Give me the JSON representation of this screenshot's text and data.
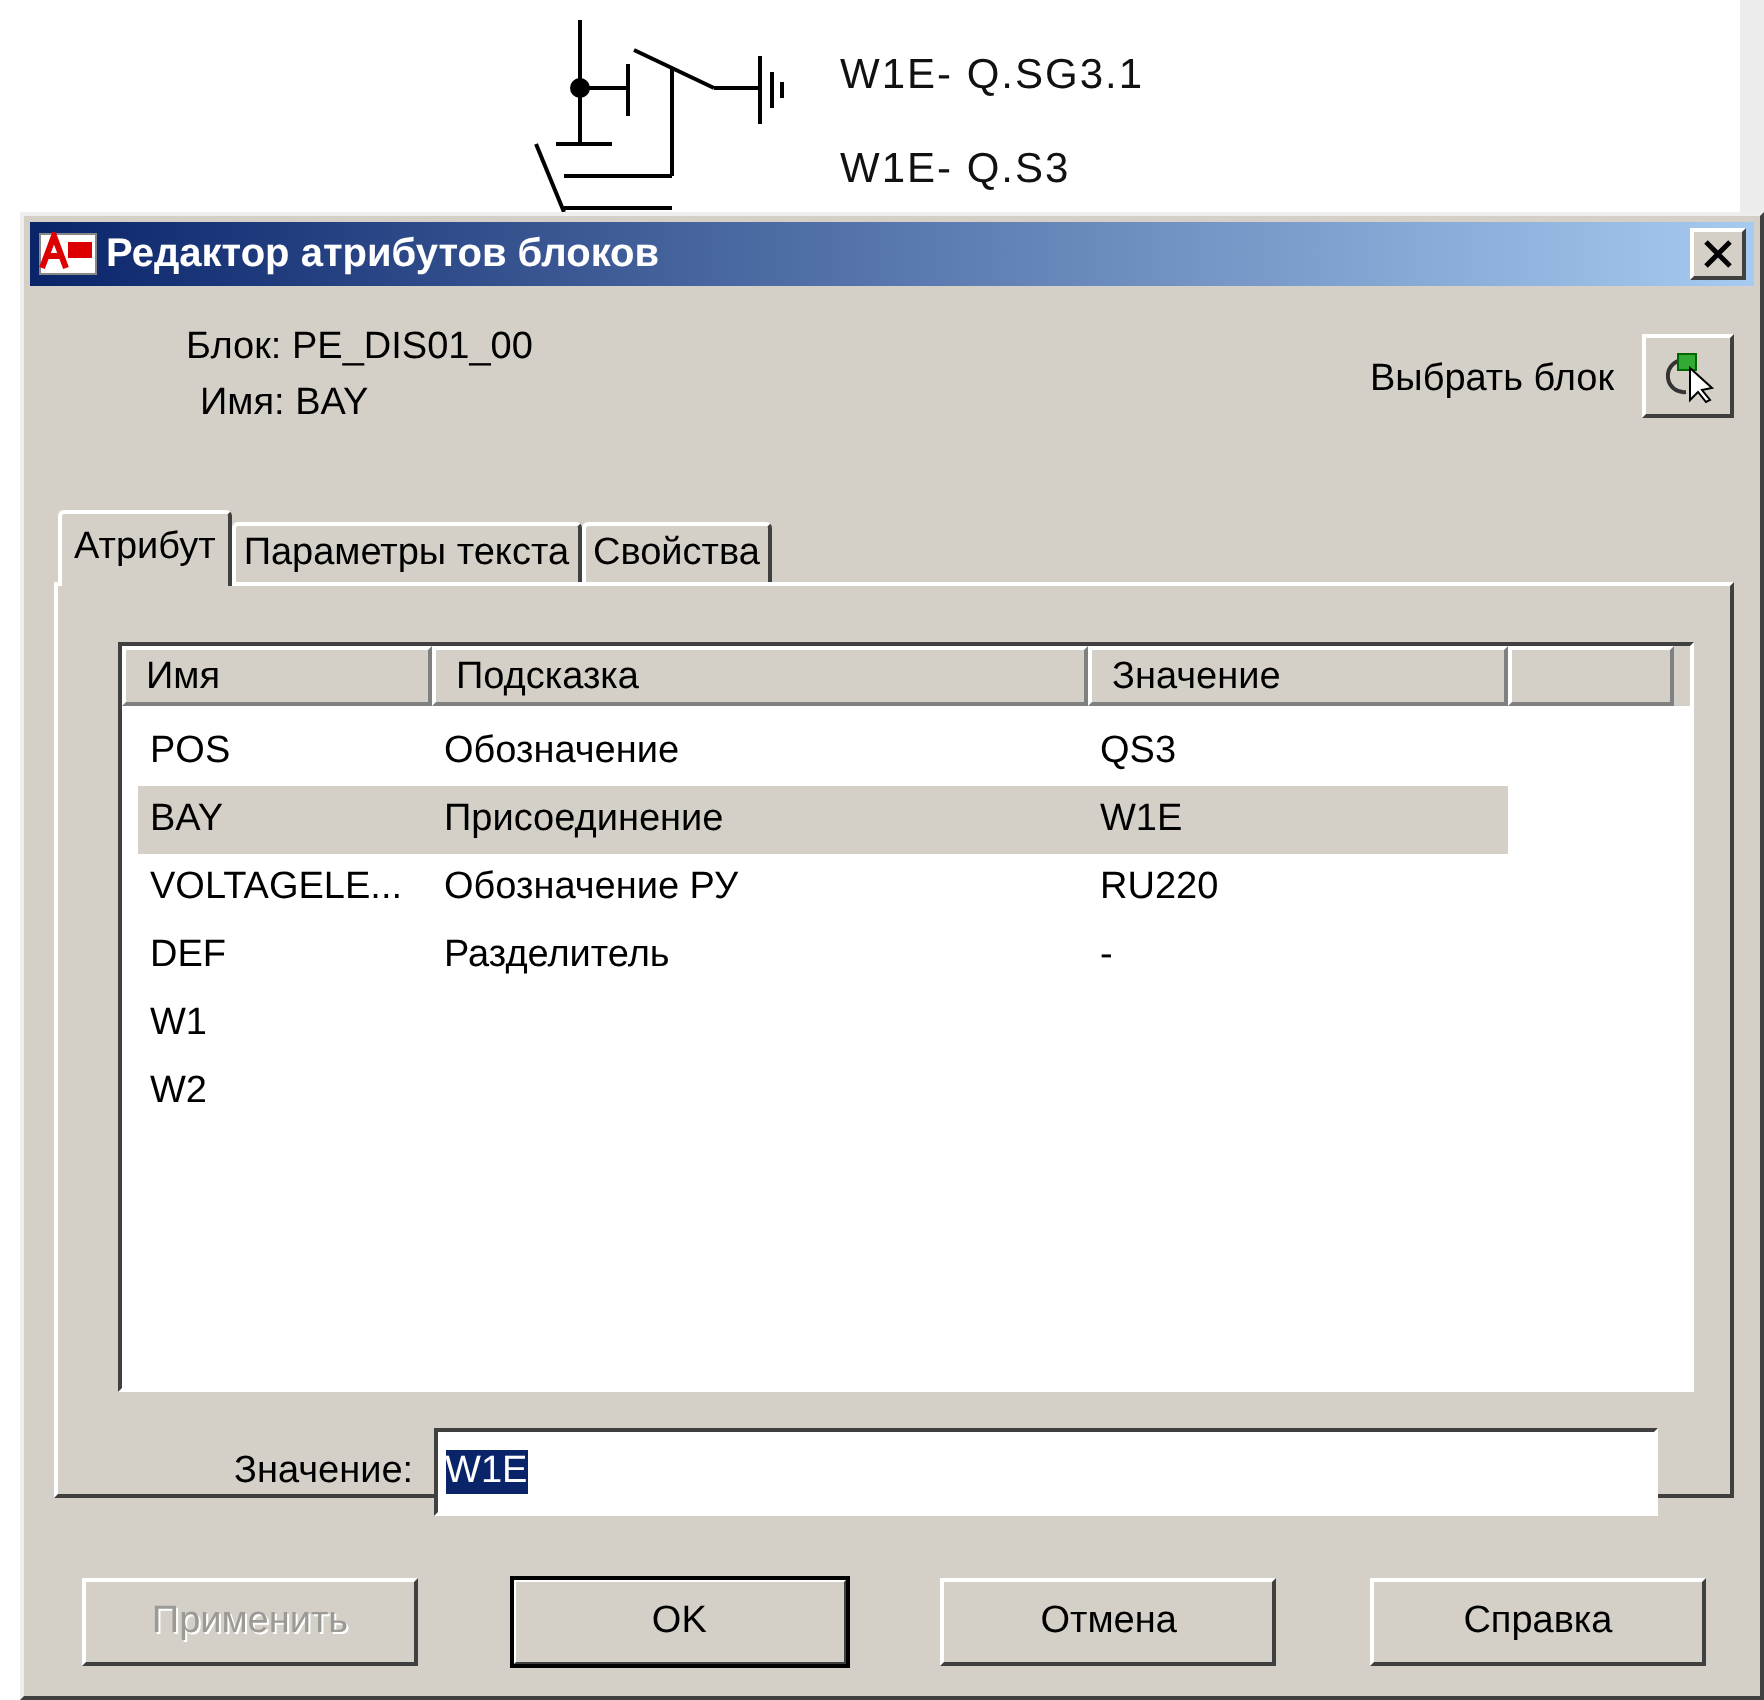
{
  "drawing": {
    "labels": [
      "W1E- Q.SG3.1",
      "W1E- Q.S3"
    ]
  },
  "window": {
    "title": "Редактор атрибутов блоков"
  },
  "block": {
    "block_line": "Блок: PE_DIS01_00",
    "name_line": "Имя: BAY",
    "pick_label": "Выбрать блок"
  },
  "tabs": [
    {
      "label": "Атрибут",
      "selected": true
    },
    {
      "label": "Параметры текста",
      "selected": false
    },
    {
      "label": "Свойства",
      "selected": false
    }
  ],
  "table": {
    "columns": [
      "Имя",
      "Подсказка",
      "Значение"
    ],
    "rows": [
      {
        "cells": [
          "POS",
          "Обозначение",
          "QS3"
        ],
        "selected": false
      },
      {
        "cells": [
          "BAY",
          "Присоединение",
          "W1E"
        ],
        "selected": true
      },
      {
        "cells": [
          "VOLTAGELE...",
          "Обозначение РУ",
          "RU220"
        ],
        "selected": false
      },
      {
        "cells": [
          "DEF",
          "Разделитель",
          "-"
        ],
        "selected": false
      },
      {
        "cells": [
          "W1"
        ],
        "selected": false
      },
      {
        "cells": [
          "W2"
        ],
        "selected": false
      }
    ]
  },
  "value_field": {
    "label": "Значение:",
    "value": "W1E"
  },
  "buttons": [
    {
      "label": "Применить",
      "disabled": true,
      "default": false
    },
    {
      "label": "OK",
      "disabled": false,
      "default": true
    },
    {
      "label": "Отмена",
      "disabled": false,
      "default": false
    },
    {
      "label": "Справка",
      "disabled": false,
      "default": false
    }
  ]
}
